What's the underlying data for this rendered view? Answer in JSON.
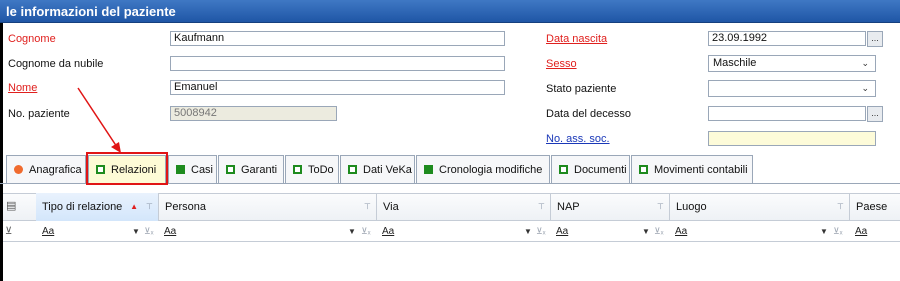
{
  "title": "le informazioni del paziente",
  "form": {
    "cognome_label": "Cognome",
    "cognome_value": "Kaufmann",
    "cognome_nubile_label": "Cognome da nubile",
    "cognome_nubile_value": "",
    "nome_label": "Nome",
    "nome_value": "Emanuel",
    "no_paziente_label": "No. paziente",
    "no_paziente_value": "5008942",
    "data_nascita_label": "Data nascita",
    "data_nascita_value": "23.09.1992",
    "sesso_label": "Sesso",
    "sesso_value": "Maschile",
    "stato_label": "Stato paziente",
    "stato_value": "",
    "decesso_label": "Data del decesso",
    "decesso_value": "",
    "ass_soc_label": "No. ass. soc.",
    "ass_soc_value": "",
    "ellipsis": "..."
  },
  "tabs": [
    {
      "label": "Anagrafica",
      "icon": "orange-dot-icon"
    },
    {
      "label": "Relazioni",
      "icon": "green-square-outline-icon"
    },
    {
      "label": "Casi",
      "icon": "green-square-filled-icon"
    },
    {
      "label": "Garanti",
      "icon": "green-square-outline-icon"
    },
    {
      "label": "ToDo",
      "icon": "green-square-outline-icon"
    },
    {
      "label": "Dati VeKa",
      "icon": "green-square-outline-icon"
    },
    {
      "label": "Cronologia modifiche",
      "icon": "green-square-filled-icon"
    },
    {
      "label": "Documenti",
      "icon": "green-square-outline-icon"
    },
    {
      "label": "Movimenti contabili",
      "icon": "green-square-outline-icon"
    }
  ],
  "active_tab": "Relazioni",
  "grid": {
    "columns": [
      "Tipo di relazione",
      "Persona",
      "Via",
      "NAP",
      "Luogo",
      "Paese"
    ],
    "filter_text": "Aa",
    "sorted_column": "Tipo di relazione"
  },
  "colors": {
    "title_bar": "#2a63b3",
    "required": "#e0201e",
    "link": "#1a38b8",
    "highlight": "#e01515",
    "active_tab": "#fdfbd6"
  }
}
